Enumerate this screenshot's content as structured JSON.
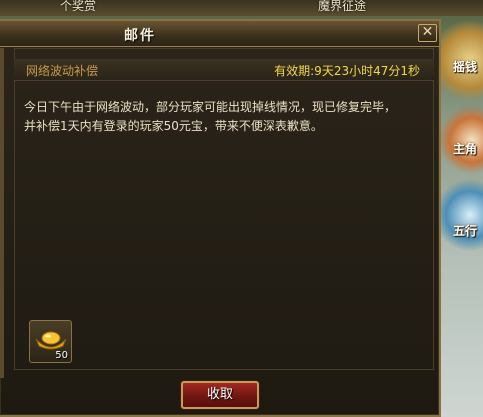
{
  "background": {
    "top_texts": [
      "个奖赏",
      "魔界征途"
    ],
    "right_labels": [
      "摇钱",
      "主角",
      "五行"
    ]
  },
  "mail_window": {
    "title": "邮件",
    "close_label": "✕",
    "subject": "网络波动补偿",
    "expiry": "有效期:9天23小时47分1秒",
    "body_lines": [
      "今日下午由于网络波动，部分玩家可能出现掉线情况，现已修复完毕，",
      "并补偿1天内有登录的玩家50元宝，带来不便深表歉意。"
    ],
    "attachment": {
      "icon": "gold-ingot-icon",
      "count": "50"
    },
    "receive_label": "收取"
  },
  "colors": {
    "subject": "#c79a4b",
    "expiry": "#f2d84a",
    "body": "#ecdfc4",
    "button": "#8a1f18"
  }
}
